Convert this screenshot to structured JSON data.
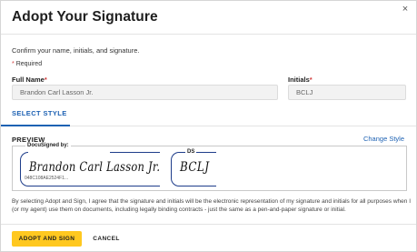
{
  "dialog": {
    "title": "Adopt Your Signature",
    "close_icon": "close-icon",
    "close_glyph": "×",
    "subtitle": "Confirm your name, initials, and signature.",
    "required_star": "*",
    "required_text": "Required"
  },
  "fields": {
    "full_name_label": "Full Name",
    "full_name_value": "Brandon Carl Lasson Jr.",
    "initials_label": "Initials",
    "initials_value": "BCLJ",
    "required_star": "*"
  },
  "tabs": {
    "select_style": "SELECT STYLE"
  },
  "preview": {
    "label": "PREVIEW",
    "change_style": "Change Style",
    "signature_caption": "DocuSigned by:",
    "signature_text": "Brandon Carl Lasson Jr.",
    "signature_hash": "048C108AE2524F1...",
    "initials_caption": "DS",
    "initials_text": "BCLJ"
  },
  "legal_text": "By selecting Adopt and Sign, I agree that the signature and initials will be the electronic representation of my signature and initials for all purposes when I (or my agent) use them on documents, including legally binding contracts - just the same as a pen-and-paper signature or initial.",
  "footer": {
    "adopt_label": "ADOPT AND SIGN",
    "cancel_label": "CANCEL"
  },
  "colors": {
    "accent_blue": "#1e62b3",
    "frame_navy": "#1e3d8a",
    "primary_button": "#ffc820",
    "required_red": "#d23c3c"
  }
}
